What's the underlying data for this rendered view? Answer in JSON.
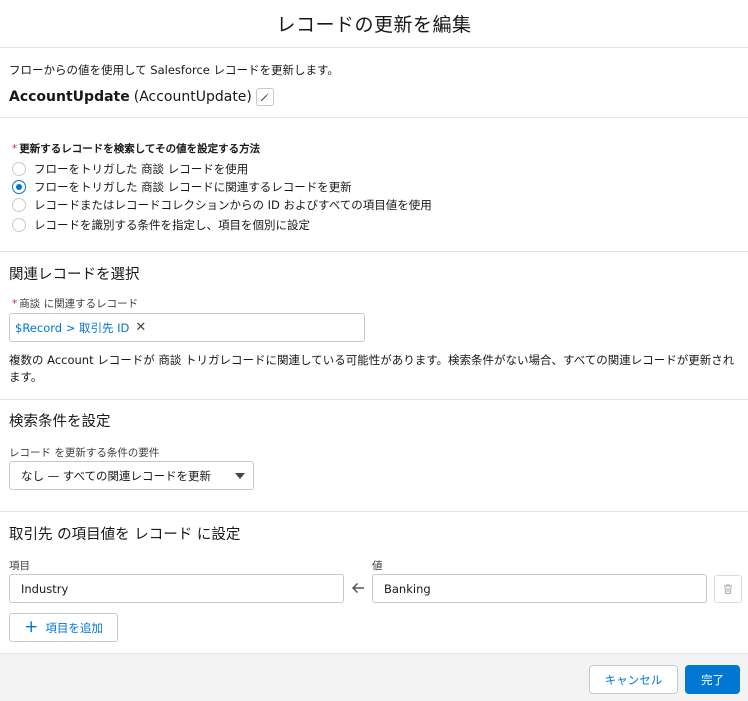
{
  "modal": {
    "title": "レコードの更新を編集"
  },
  "intro": {
    "description": "フローからの値を使用して Salesforce レコードを更新します。",
    "label": "AccountUpdate",
    "api_name": "(AccountUpdate)"
  },
  "method": {
    "label": "更新するレコードを検索してその値を設定する方法",
    "options": [
      {
        "label": "フローをトリガした 商談 レコードを使用",
        "checked": false
      },
      {
        "label": "フローをトリガした 商談 レコードに関連するレコードを更新",
        "checked": true
      },
      {
        "label": "レコードまたはレコードコレクションからの ID およびすべての項目値を使用",
        "checked": false
      },
      {
        "label": "レコードを識別する条件を指定し、項目を個別に設定",
        "checked": false
      }
    ]
  },
  "related": {
    "section_title": "関連レコードを選択",
    "field_label": "商談 に関連するレコード",
    "pill_value": "$Record > 取引先 ID",
    "info_text": "複数の Account レコードが 商談 トリガレコードに関連している可能性があります。検索条件がない場合、すべての関連レコードが更新されます。"
  },
  "filter": {
    "section_title": "検索条件を設定",
    "field_label": "レコード を更新する条件の要件",
    "selected": "なし — すべての関連レコードを更新"
  },
  "fields": {
    "section_title": "取引先 の項目値を レコード に設定",
    "field_header": "項目",
    "value_header": "値",
    "rows": [
      {
        "field": "Industry",
        "value": "Banking"
      }
    ],
    "add_label": "項目を追加"
  },
  "footer": {
    "cancel_label": "キャンセル",
    "done_label": "完了"
  },
  "colors": {
    "brand": "#0176d3",
    "required": "#c23934",
    "border": "#c9c9c9",
    "footer_bg": "#f3f3f3"
  }
}
